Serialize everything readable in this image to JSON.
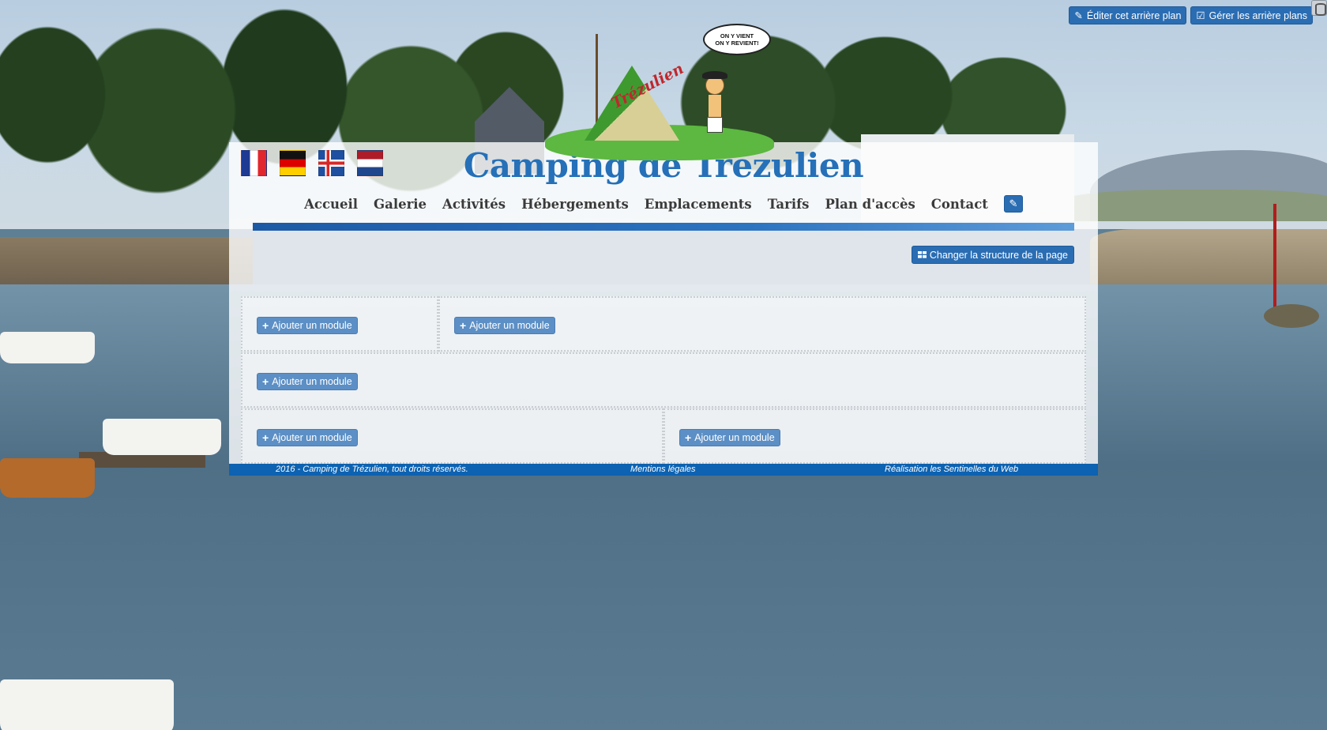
{
  "admin": {
    "edit_background_label": "Éditer cet arrière plan",
    "manage_backgrounds_label": "Gérer les arrière plans",
    "change_structure_label": "Changer la structure de la page"
  },
  "logo": {
    "brand_text": "Trézulien",
    "speech_line1": "ON Y VIENT",
    "speech_line2": "ON Y REVIENT!"
  },
  "flags": [
    {
      "icon": "flag-france-icon"
    },
    {
      "icon": "flag-germany-icon"
    },
    {
      "icon": "flag-iceland-icon"
    },
    {
      "icon": "flag-netherlands-icon"
    }
  ],
  "site": {
    "title": "Camping de Trézulien"
  },
  "nav": {
    "items": [
      "Accueil",
      "Galerie",
      "Activités",
      "Hébergements",
      "Emplacements",
      "Tarifs",
      "Plan d'accès",
      "Contact"
    ],
    "edit_icon": "edit-icon"
  },
  "zones": {
    "add_module_label": "Ajouter un module"
  },
  "footer": {
    "copyright": "2016  - Camping de Trézulien, tout droits réservés.",
    "legal": "Mentions légales",
    "credit": "Réalisation les Sentinelles du Web"
  },
  "colors": {
    "brand_blue": "#2570b8",
    "button_blue": "#2a6db3",
    "footer_blue": "#0d62b1"
  }
}
